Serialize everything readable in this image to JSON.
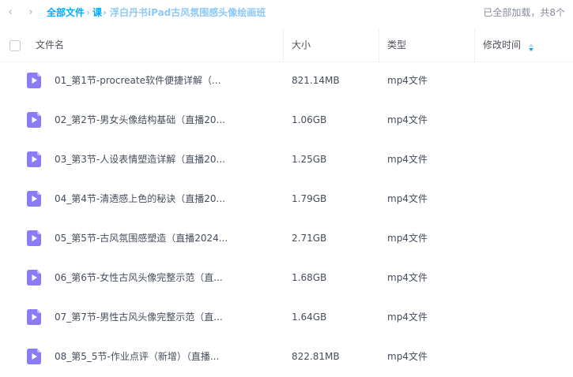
{
  "nav": {
    "back_glyph": "‹",
    "forward_glyph": "›"
  },
  "breadcrumb": {
    "root": "全部文件",
    "sep1": "›",
    "level1": "课",
    "sep2": "›",
    "current": "浮白丹书iPad古风氛围感头像绘画班"
  },
  "status_text": "已全部加载，共8个",
  "columns": {
    "name": "文件名",
    "size": "大小",
    "type": "类型",
    "modified": "修改时间"
  },
  "files": [
    {
      "name": "01_第1节-procreate软件便捷详解（...",
      "size": "821.14MB",
      "type": "mp4文件",
      "icon": "video-file-icon"
    },
    {
      "name": "02_第2节-男女头像结构基础（直播20...",
      "size": "1.06GB",
      "type": "mp4文件",
      "icon": "video-file-icon"
    },
    {
      "name": "03_第3节-人设表情塑造详解（直播20...",
      "size": "1.25GB",
      "type": "mp4文件",
      "icon": "video-file-icon"
    },
    {
      "name": "04_第4节-清透感上色的秘诀（直播20...",
      "size": "1.79GB",
      "type": "mp4文件",
      "icon": "video-file-icon"
    },
    {
      "name": "05_第5节-古风氛围感塑造（直播2024...",
      "size": "2.71GB",
      "type": "mp4文件",
      "icon": "video-file-icon"
    },
    {
      "name": "06_第6节-女性古风头像完整示范（直...",
      "size": "1.68GB",
      "type": "mp4文件",
      "icon": "video-file-icon"
    },
    {
      "name": "07_第7节-男性古风头像完整示范（直...",
      "size": "1.64GB",
      "type": "mp4文件",
      "icon": "video-file-icon"
    },
    {
      "name": "08_第5_5节-作业点评（新增）（直播...",
      "size": "822.81MB",
      "type": "mp4文件",
      "icon": "video-file-icon"
    }
  ],
  "colors": {
    "accent": "#06a7ff",
    "file_icon": "#8b7cf6",
    "file_icon_fold": "#c4bbfb"
  }
}
